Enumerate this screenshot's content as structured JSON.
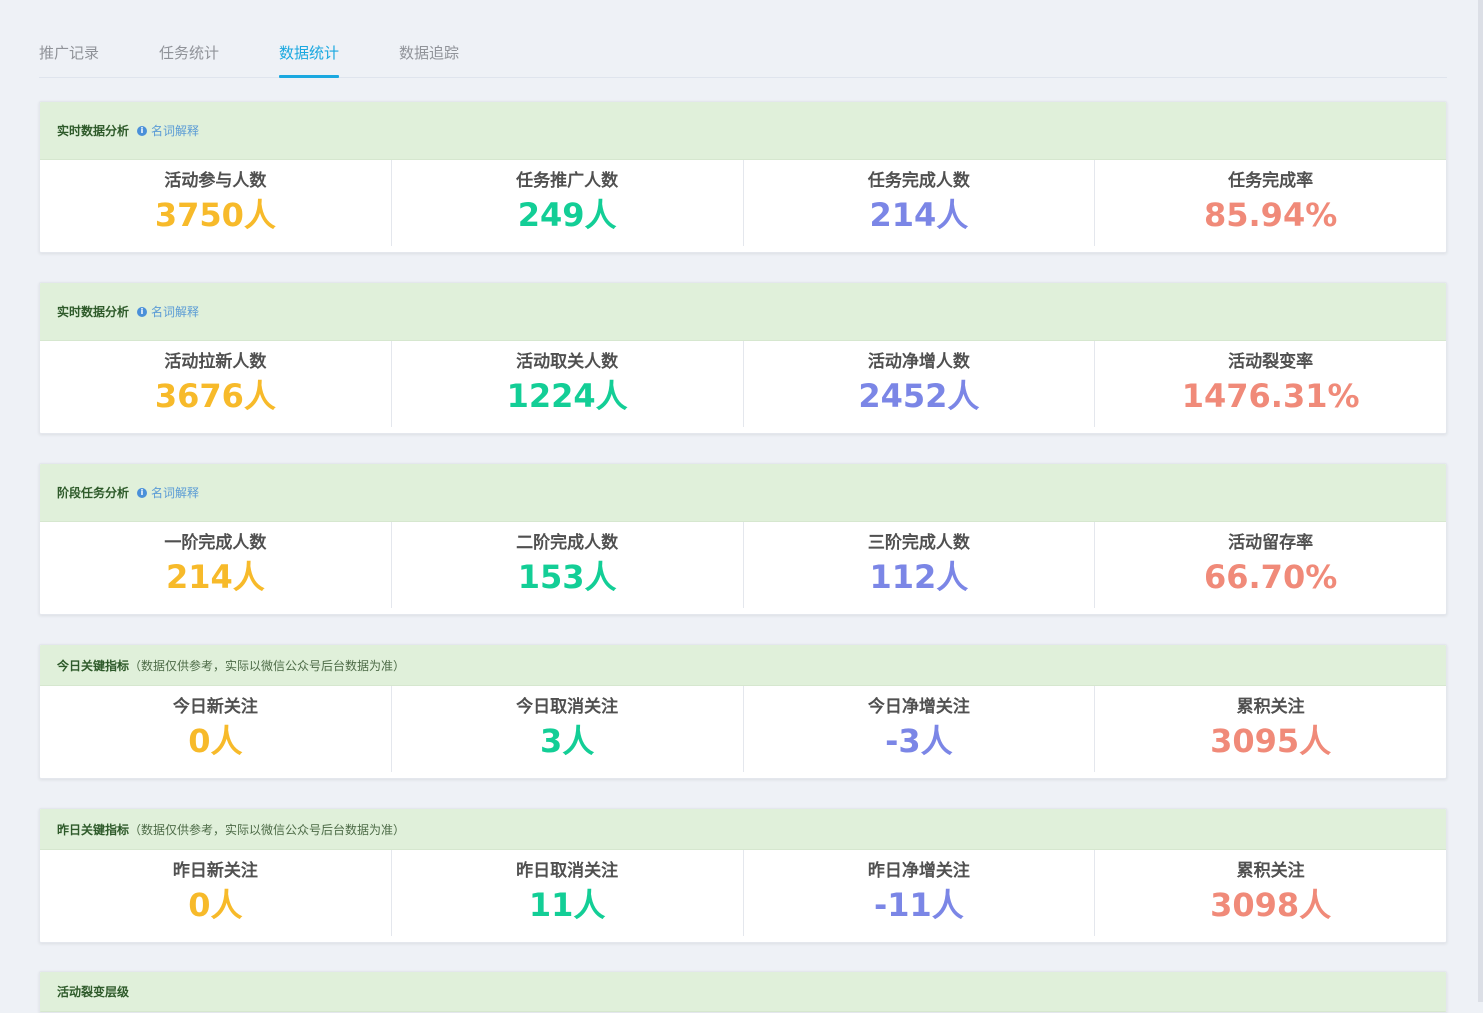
{
  "tabs": [
    {
      "label": "推广记录",
      "active": false
    },
    {
      "label": "任务统计",
      "active": false
    },
    {
      "label": "数据统计",
      "active": true
    },
    {
      "label": "数据追踪",
      "active": false
    }
  ],
  "colors": {
    "orange": "#f7ba2a",
    "green": "#13ce96",
    "blue": "#7b86e6",
    "red": "#f08a79",
    "header_bg": "#e0f0da",
    "tab_active": "#1aa8e0"
  },
  "sections": [
    {
      "title": "实时数据分析",
      "hint": "名词解释",
      "metrics": [
        {
          "label": "活动参与人数",
          "value": "3750人"
        },
        {
          "label": "任务推广人数",
          "value": "249人"
        },
        {
          "label": "任务完成人数",
          "value": "214人"
        },
        {
          "label": "任务完成率",
          "value": "85.94%"
        }
      ]
    },
    {
      "title": "实时数据分析",
      "hint": "名词解释",
      "metrics": [
        {
          "label": "活动拉新人数",
          "value": "3676人"
        },
        {
          "label": "活动取关人数",
          "value": "1224人"
        },
        {
          "label": "活动净增人数",
          "value": "2452人"
        },
        {
          "label": "活动裂变率",
          "value": "1476.31%"
        }
      ]
    },
    {
      "title": "阶段任务分析",
      "hint": "名词解释",
      "metrics": [
        {
          "label": "一阶完成人数",
          "value": "214人"
        },
        {
          "label": "二阶完成人数",
          "value": "153人"
        },
        {
          "label": "三阶完成人数",
          "value": "112人"
        },
        {
          "label": "活动留存率",
          "value": "66.70%"
        }
      ]
    },
    {
      "title": "今日关键指标",
      "note": "（数据仅供参考，实际以微信公众号后台数据为准）",
      "metrics": [
        {
          "label": "今日新关注",
          "value": "0人"
        },
        {
          "label": "今日取消关注",
          "value": "3人"
        },
        {
          "label": "今日净增关注",
          "value": "-3人"
        },
        {
          "label": "累积关注",
          "value": "3095人"
        }
      ]
    },
    {
      "title": "昨日关键指标",
      "note": "（数据仅供参考，实际以微信公众号后台数据为准）",
      "metrics": [
        {
          "label": "昨日新关注",
          "value": "0人"
        },
        {
          "label": "昨日取消关注",
          "value": "11人"
        },
        {
          "label": "昨日净增关注",
          "value": "-11人"
        },
        {
          "label": "累积关注",
          "value": "3098人"
        }
      ]
    },
    {
      "title": "活动裂变层级"
    }
  ]
}
